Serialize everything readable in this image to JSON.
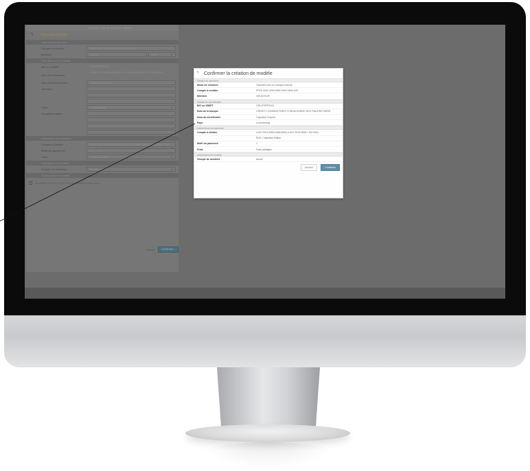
{
  "background_form": {
    "top_text": "Nouveau ordre de virement • Modèle",
    "title": "Nouveau modèle",
    "sections": {
      "ordering": "Données du donneur",
      "beneficiary": "Données du bénéficiaire",
      "instructions": "Instructions de paiement",
      "template": "Instructions du modèle",
      "save": "Sauvegarde du modèle"
    },
    "rows": {
      "account_label": "Compte à créditer",
      "account_value": "FR76 3000 2005 5000 0000 0000 K43",
      "amount_label": "Montant",
      "amount_value": "100,00",
      "currency_value": "EUR",
      "bic_label": "BIC ou SWIFT",
      "bic_value": "CRLYFRPPXXX",
      "bank_label": "Nom de la banque",
      "bank_value": "CREDIT LYONNAIS PARIS 19 BOULEVARD DES ITALIENS",
      "beneficiary_name_label": "Nom du bénéficiaire",
      "beneficiary_name_value": "Capucine Dupont",
      "address_label": "Adresse",
      "country_label": "Pays",
      "country_value": "Luxembourg",
      "additional_label": "Complémentaire",
      "debit_label": "Compte à débiter",
      "debit_value": "LU57 0019 5955 0668 8000 (1 LU57 0019 5955 0668 8000 / 100 000)",
      "reason_label": "Motif du paiement",
      "reason_value": "1",
      "fees_label": "Frais",
      "fees_value": "Frais partagés",
      "group_label": "Groupe de modèles",
      "group_value": "Aucun"
    },
    "checkbox_label": "Je déclare avoir lu toutes les modifications intégrales",
    "cancel_label": "Annuler",
    "confirm_label": "Confirmer"
  },
  "modal": {
    "title": "Confirmer la création de modèle",
    "sections": {
      "ordering": "Détails du virement",
      "beneficiary": "Détails du bénéficiaire",
      "payment": "Instructions de paiement",
      "template": "Instructions de modèle"
    },
    "rows": [
      {
        "key": "Mode de virement",
        "value": "Transfert vers un compte externe"
      },
      {
        "key": "Compte à créditer",
        "value": "FR76 3000 2005 5000 0000 0000 K43"
      },
      {
        "key": "Montant",
        "value": "100,00 EUR"
      }
    ],
    "beneficiary_rows": [
      {
        "key": "BIC ou SWIFT",
        "value": "CRLYFRPPXXX"
      },
      {
        "key": "Nom de la banque",
        "value": "CREDIT LYONNAIS PARIS 19 BOULEVARD DES ITALIENS PARIS"
      },
      {
        "key": "Nom du bénéficiaire",
        "value": "Capucine Dupont"
      },
      {
        "key": "Pays",
        "value": "Luxembourg"
      }
    ],
    "payment_rows": [
      {
        "key": "Compte à débiter",
        "value": "LU57 0019 5955 0668 8000 (LU57 0019 5955 / 100 000)"
      },
      {
        "key": "",
        "value": "EUR / Valentine Blaise"
      },
      {
        "key": "Motif du paiement",
        "value": "1"
      },
      {
        "key": "Frais",
        "value": "Frais partagés"
      }
    ],
    "template_rows": [
      {
        "key": "Groupe de modèles",
        "value": "Aucun"
      }
    ],
    "cancel_label": "Annuler",
    "confirm_label": "Confirmer"
  },
  "colors": {
    "overlay": "#6c6c6c",
    "accent": "#5f8fa8",
    "bezel": "#0b0b0c"
  }
}
